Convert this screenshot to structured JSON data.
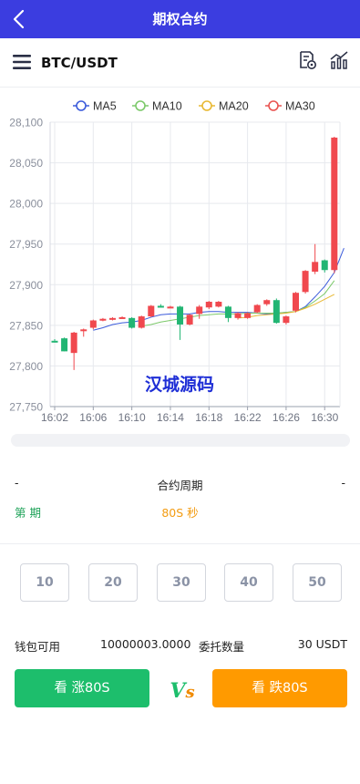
{
  "header": {
    "title": "期权合约",
    "back_icon": "chevron-left-icon"
  },
  "pair_bar": {
    "symbol": "BTC/USDT",
    "menu_icon": "hamburger-menu-icon",
    "tool_icons": [
      "order-record-icon",
      "chart-indicator-icon"
    ]
  },
  "chart_data": {
    "type": "candlestick",
    "legend": [
      {
        "name": "MA5",
        "color": "#3b5bdb"
      },
      {
        "name": "MA10",
        "color": "#7cc96a"
      },
      {
        "name": "MA20",
        "color": "#e8b833"
      },
      {
        "name": "MA30",
        "color": "#e95350"
      }
    ],
    "legend_position": "top-center",
    "ylim": [
      27750,
      28100
    ],
    "y_ticks": [
      27750,
      27800,
      27850,
      27900,
      27950,
      28000,
      28050,
      28100
    ],
    "y_tick_labels": [
      "27,750",
      "27,800",
      "27,850",
      "27,900",
      "27,950",
      "28,000",
      "28,050",
      "28,100"
    ],
    "x_labels": [
      "16:02",
      "16:06",
      "16:10",
      "16:14",
      "16:18",
      "16:22",
      "16:26",
      "16:30"
    ],
    "grid": true,
    "watermark": "汉城源码",
    "candles": [
      {
        "t": 0,
        "o": 27831,
        "h": 27833,
        "l": 27829,
        "c": 27830,
        "dir": "up"
      },
      {
        "t": 1,
        "o": 27834,
        "h": 27835,
        "l": 27818,
        "c": 27818,
        "dir": "up"
      },
      {
        "t": 2,
        "o": 27816,
        "h": 27842,
        "l": 27795,
        "c": 27841,
        "dir": "down"
      },
      {
        "t": 3,
        "o": 27843,
        "h": 27846,
        "l": 27836,
        "c": 27845,
        "dir": "down"
      },
      {
        "t": 4,
        "o": 27847,
        "h": 27857,
        "l": 27845,
        "c": 27856,
        "dir": "down"
      },
      {
        "t": 5,
        "o": 27856,
        "h": 27859,
        "l": 27855,
        "c": 27858,
        "dir": "down"
      },
      {
        "t": 6,
        "o": 27858,
        "h": 27860,
        "l": 27856,
        "c": 27859,
        "dir": "down"
      },
      {
        "t": 7,
        "o": 27859,
        "h": 27861,
        "l": 27858,
        "c": 27860,
        "dir": "down"
      },
      {
        "t": 8,
        "o": 27859,
        "h": 27860,
        "l": 27846,
        "c": 27847,
        "dir": "up"
      },
      {
        "t": 9,
        "o": 27847,
        "h": 27862,
        "l": 27846,
        "c": 27861,
        "dir": "down"
      },
      {
        "t": 10,
        "o": 27861,
        "h": 27875,
        "l": 27860,
        "c": 27874,
        "dir": "down"
      },
      {
        "t": 11,
        "o": 27874,
        "h": 27876,
        "l": 27872,
        "c": 27873,
        "dir": "up"
      },
      {
        "t": 12,
        "o": 27872,
        "h": 27874,
        "l": 27871,
        "c": 27873,
        "dir": "down"
      },
      {
        "t": 13,
        "o": 27873,
        "h": 27874,
        "l": 27832,
        "c": 27851,
        "dir": "up"
      },
      {
        "t": 14,
        "o": 27851,
        "h": 27864,
        "l": 27850,
        "c": 27863,
        "dir": "down"
      },
      {
        "t": 15,
        "o": 27864,
        "h": 27875,
        "l": 27858,
        "c": 27873,
        "dir": "down"
      },
      {
        "t": 16,
        "o": 27872,
        "h": 27880,
        "l": 27870,
        "c": 27879,
        "dir": "down"
      },
      {
        "t": 17,
        "o": 27879,
        "h": 27880,
        "l": 27872,
        "c": 27873,
        "dir": "down"
      },
      {
        "t": 18,
        "o": 27873,
        "h": 27874,
        "l": 27854,
        "c": 27859,
        "dir": "up"
      },
      {
        "t": 19,
        "o": 27859,
        "h": 27866,
        "l": 27857,
        "c": 27865,
        "dir": "down"
      },
      {
        "t": 20,
        "o": 27865,
        "h": 27866,
        "l": 27858,
        "c": 27859,
        "dir": "down"
      },
      {
        "t": 21,
        "o": 27866,
        "h": 27876,
        "l": 27865,
        "c": 27875,
        "dir": "down"
      },
      {
        "t": 22,
        "o": 27876,
        "h": 27882,
        "l": 27874,
        "c": 27881,
        "dir": "down"
      },
      {
        "t": 23,
        "o": 27881,
        "h": 27883,
        "l": 27852,
        "c": 27853,
        "dir": "up"
      },
      {
        "t": 24,
        "o": 27853,
        "h": 27862,
        "l": 27851,
        "c": 27861,
        "dir": "down"
      },
      {
        "t": 25,
        "o": 27868,
        "h": 27891,
        "l": 27866,
        "c": 27890,
        "dir": "down"
      },
      {
        "t": 26,
        "o": 27891,
        "h": 27918,
        "l": 27889,
        "c": 27917,
        "dir": "down"
      },
      {
        "t": 27,
        "o": 27916,
        "h": 27950,
        "l": 27913,
        "c": 27928,
        "dir": "down"
      },
      {
        "t": 28,
        "o": 27930,
        "h": 27931,
        "l": 27915,
        "c": 27918,
        "dir": "up"
      },
      {
        "t": 29,
        "o": 27918,
        "h": 28082,
        "l": 27914,
        "c": 28081,
        "dir": "down"
      }
    ],
    "ma_lines": [
      {
        "name": "MA5",
        "color": "#3b5bdb",
        "start": 4,
        "values": [
          27844,
          27847,
          27851,
          27853,
          27854,
          27856,
          27860,
          27863,
          27864,
          27864,
          27864,
          27866,
          27867,
          27867,
          27866,
          27866,
          27866,
          27865,
          27864,
          27865,
          27866,
          27867,
          27873,
          27885,
          27898,
          27915,
          27945
        ]
      },
      {
        "name": "MA10",
        "color": "#7cc96a",
        "start": 9,
        "values": [
          27849,
          27851,
          27854,
          27856,
          27858,
          27860,
          27862,
          27863,
          27864,
          27864,
          27864,
          27865,
          27865,
          27865,
          27865,
          27866,
          27867,
          27872,
          27880,
          27889,
          27905
        ]
      },
      {
        "name": "MA20",
        "color": "#e8b833",
        "start": 19,
        "values": [
          27859,
          27860,
          27862,
          27863,
          27864,
          27865,
          27867,
          27871,
          27876,
          27882,
          27888
        ]
      },
      {
        "name": "MA30",
        "color": "#e95350",
        "start": 29,
        "values": [
          27866
        ]
      }
    ]
  },
  "contract": {
    "period_left": "-",
    "period_label": "合约周期",
    "period_right": "-",
    "term_label": "第 期",
    "term_value": "80S 秒"
  },
  "amounts": [
    "10",
    "20",
    "30",
    "40",
    "50"
  ],
  "wallet": {
    "label": "钱包可用",
    "value": "10000003.0000",
    "entrust_label": "委托数量",
    "entrust_value": "30 USDT"
  },
  "actions": {
    "up_label": "看 涨80S",
    "down_label": "看 跌80S",
    "vs_v": "V",
    "vs_s": "s",
    "up_color": "#1dbe6c",
    "down_color": "#ff9a00"
  }
}
